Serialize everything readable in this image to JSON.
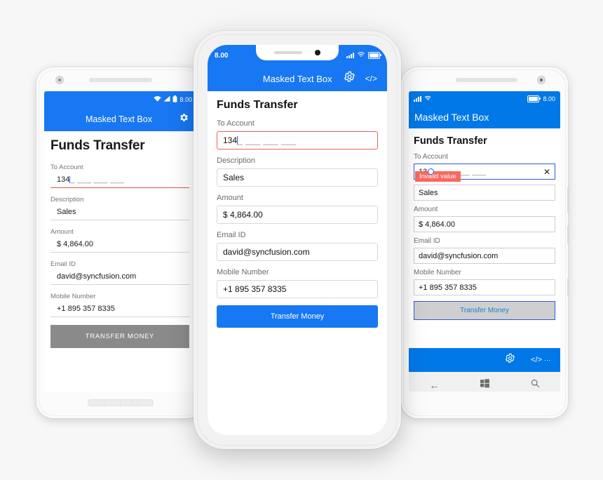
{
  "app": {
    "title": "Masked Text Box",
    "heading": "Funds Transfer",
    "status_time": "8.00"
  },
  "form": {
    "labels": {
      "to_account": "To Account",
      "description": "Description",
      "amount": "Amount",
      "email": "Email ID",
      "mobile": "Mobile Number"
    },
    "values": {
      "to_account_typed": "134",
      "to_account_mask": "_ ___ ___ ___",
      "description": "Sales",
      "amount": "$ 4,864.00",
      "email": "david@syncfusion.com",
      "mobile": "+1 895 357 8335"
    },
    "validation": {
      "message": "Invalid value"
    }
  },
  "buttons": {
    "transfer_android": "TRANSFER MONEY",
    "transfer_ios": "Transfer Money",
    "transfer_windows": "Transfer Money"
  },
  "icons": {
    "settings": "gear-icon",
    "code": "code-icon",
    "clear": "✕",
    "back": "←",
    "search": "⌕",
    "overflow": "···"
  },
  "colors": {
    "android_accent": "#1877f2",
    "ios_accent": "#1877f2",
    "windows_accent": "#0078e7",
    "error": "#e8534f",
    "tooltip": "#f8695f",
    "android_disabled_button": "#8a8a8a",
    "windows_button": "#cfcfcf"
  }
}
